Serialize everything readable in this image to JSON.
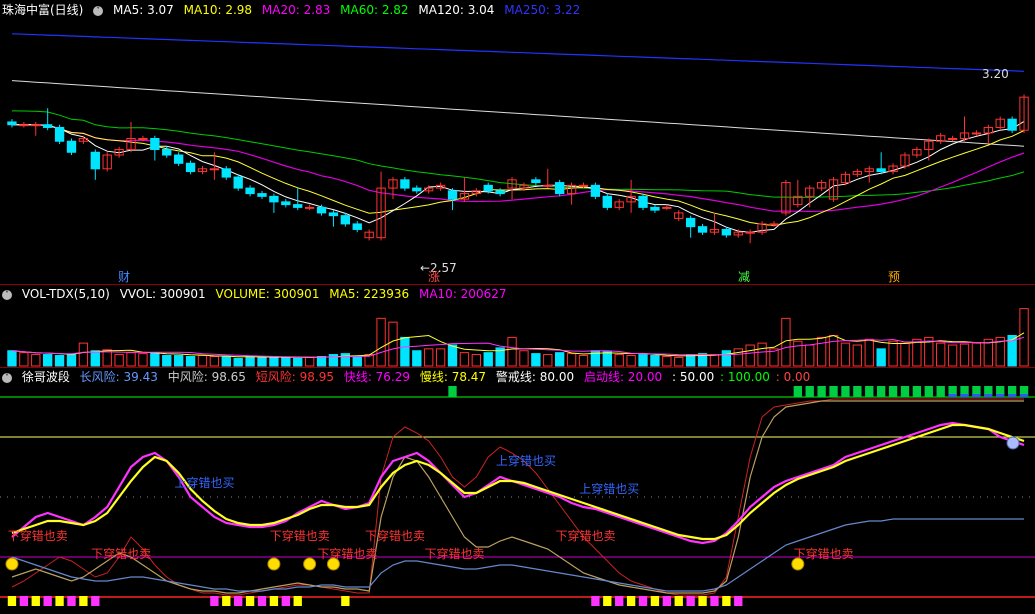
{
  "price_panel": {
    "security": "珠海中富(日线)",
    "indicators": [
      {
        "label": "MA5: 3.07",
        "color": "#ffffff"
      },
      {
        "label": "MA10: 2.98",
        "color": "#ffff00"
      },
      {
        "label": "MA20: 2.83",
        "color": "#ff00ff"
      },
      {
        "label": "MA60: 2.82",
        "color": "#00ff00"
      },
      {
        "label": "MA120: 3.04",
        "color": "#ffffff"
      },
      {
        "label": "MA250: 3.22",
        "color": "#3333ff"
      }
    ],
    "high_label": "3.20",
    "low_label": "2.57",
    "event_tags": [
      "财",
      "涨",
      "减",
      "预"
    ],
    "event_colors": [
      "#4488ff",
      "#ff4444",
      "#44ff44",
      "#ffaa00"
    ]
  },
  "volume_panel": {
    "title": "VOL-TDX(5,10)",
    "indicators": [
      {
        "label": "VVOL: 300901",
        "color": "#ffffff"
      },
      {
        "label": "VOLUME: 300901",
        "color": "#ffff00"
      },
      {
        "label": "MA5: 223936",
        "color": "#ffff00"
      },
      {
        "label": "MA10: 200627",
        "color": "#ff00ff"
      }
    ]
  },
  "oscillator_panel": {
    "title": "徐哥波段",
    "indicators": [
      {
        "label": "长风险: 39.43",
        "color": "#6699ff"
      },
      {
        "label": "中风险: 98.65",
        "color": "#cccccc"
      },
      {
        "label": "短风险: 98.95",
        "color": "#ff3333"
      },
      {
        "label": "快线: 76.29",
        "color": "#ff00ff"
      },
      {
        "label": "慢线: 78.47",
        "color": "#ffff00"
      },
      {
        "label": "警戒线: 80.00",
        "color": "#ffffff"
      },
      {
        "label": "启动线: 20.00",
        "color": "#ff00ff"
      },
      {
        "label": ": 50.00",
        "color": "#ffffff"
      },
      {
        "label": ": 100.00",
        "color": "#00ff00"
      },
      {
        "label": ": 0.00",
        "color": "#ff4444"
      }
    ],
    "buy_text": "上穿错也买",
    "sell_text": "下穿错也卖"
  },
  "chart_data": {
    "type": "candlestick",
    "x": [
      0,
      1,
      2,
      3,
      4,
      5,
      6,
      7,
      8,
      9,
      10,
      11,
      12,
      13,
      14,
      15,
      16,
      17,
      18,
      19,
      20,
      21,
      22,
      23,
      24,
      25,
      26,
      27,
      28,
      29,
      30,
      31,
      32,
      33,
      34,
      35,
      36,
      37,
      38,
      39,
      40,
      41,
      42,
      43,
      44,
      45,
      46,
      47,
      48,
      49,
      50,
      51,
      52,
      53,
      54,
      55,
      56,
      57,
      58,
      59,
      60,
      61,
      62,
      63,
      64,
      65,
      66,
      67,
      68,
      69,
      70,
      71,
      72,
      73,
      74,
      75,
      76,
      77,
      78,
      79,
      80,
      81,
      82,
      83,
      84,
      85
    ],
    "price": {
      "ylim": [
        2.5,
        3.4
      ],
      "open": [
        3.03,
        3.02,
        3.02,
        3.02,
        3.01,
        2.96,
        2.96,
        2.92,
        2.86,
        2.91,
        2.93,
        2.97,
        2.97,
        2.93,
        2.91,
        2.88,
        2.85,
        2.86,
        2.86,
        2.83,
        2.79,
        2.77,
        2.76,
        2.74,
        2.73,
        2.72,
        2.72,
        2.7,
        2.69,
        2.66,
        2.61,
        2.61,
        2.79,
        2.82,
        2.79,
        2.78,
        2.79,
        2.78,
        2.75,
        2.77,
        2.8,
        2.78,
        2.79,
        2.79,
        2.82,
        2.8,
        2.81,
        2.77,
        2.8,
        2.8,
        2.76,
        2.72,
        2.74,
        2.76,
        2.72,
        2.72,
        2.68,
        2.68,
        2.65,
        2.63,
        2.64,
        2.62,
        2.63,
        2.63,
        2.66,
        2.7,
        2.73,
        2.76,
        2.79,
        2.75,
        2.81,
        2.84,
        2.85,
        2.86,
        2.85,
        2.87,
        2.91,
        2.93,
        2.96,
        2.97,
        2.97,
        2.99,
        2.99,
        3.01,
        3.04,
        3.0
      ],
      "close": [
        3.02,
        3.02,
        3.02,
        3.01,
        2.96,
        2.92,
        2.97,
        2.86,
        2.91,
        2.93,
        2.97,
        2.97,
        2.93,
        2.91,
        2.88,
        2.85,
        2.86,
        2.86,
        2.83,
        2.79,
        2.77,
        2.76,
        2.74,
        2.73,
        2.72,
        2.72,
        2.7,
        2.69,
        2.66,
        2.64,
        2.63,
        2.79,
        2.82,
        2.79,
        2.78,
        2.79,
        2.8,
        2.75,
        2.77,
        2.78,
        2.78,
        2.77,
        2.82,
        2.8,
        2.81,
        2.8,
        2.77,
        2.8,
        2.8,
        2.76,
        2.72,
        2.74,
        2.76,
        2.72,
        2.71,
        2.72,
        2.7,
        2.65,
        2.63,
        2.64,
        2.62,
        2.63,
        2.63,
        2.66,
        2.66,
        2.81,
        2.76,
        2.79,
        2.81,
        2.82,
        2.84,
        2.85,
        2.86,
        2.85,
        2.87,
        2.91,
        2.93,
        2.96,
        2.98,
        2.97,
        2.99,
        2.99,
        3.01,
        3.04,
        3.0,
        3.12
      ]
    },
    "volume": {
      "ylim": [
        0,
        320000
      ],
      "values": [
        80000,
        70000,
        60000,
        60000,
        55000,
        60000,
        120000,
        80000,
        85000,
        60000,
        70000,
        65000,
        70000,
        55000,
        55000,
        50000,
        55000,
        50000,
        50000,
        40000,
        50000,
        45000,
        50000,
        45000,
        40000,
        45000,
        50000,
        60000,
        65000,
        50000,
        60000,
        250000,
        230000,
        150000,
        80000,
        90000,
        90000,
        110000,
        70000,
        60000,
        70000,
        95000,
        150000,
        80000,
        65000,
        60000,
        70000,
        65000,
        55000,
        80000,
        75000,
        60000,
        55000,
        60000,
        55000,
        50000,
        45000,
        60000,
        65000,
        60000,
        80000,
        90000,
        110000,
        120000,
        90000,
        250000,
        130000,
        110000,
        150000,
        160000,
        120000,
        110000,
        140000,
        90000,
        130000,
        120000,
        140000,
        150000,
        120000,
        110000,
        115000,
        120000,
        140000,
        150000,
        160000,
        300901
      ]
    },
    "oscillator": {
      "ylim": [
        0,
        100
      ],
      "fast": [
        30,
        35,
        40,
        42,
        40,
        38,
        36,
        40,
        45,
        55,
        65,
        70,
        72,
        68,
        60,
        50,
        45,
        40,
        37,
        36,
        35,
        35,
        36,
        38,
        42,
        45,
        48,
        46,
        44,
        45,
        47,
        60,
        68,
        70,
        72,
        68,
        62,
        56,
        50,
        52,
        56,
        60,
        58,
        56,
        54,
        52,
        50,
        47,
        45,
        44,
        42,
        40,
        38,
        36,
        34,
        32,
        30,
        28,
        27,
        28,
        32,
        38,
        45,
        50,
        55,
        58,
        60,
        62,
        64,
        66,
        70,
        72,
        74,
        76,
        78,
        80,
        82,
        84,
        86,
        87,
        86,
        85,
        84,
        80,
        78,
        76
      ],
      "slow": [
        32,
        34,
        36,
        38,
        38,
        37,
        36,
        38,
        42,
        50,
        58,
        65,
        70,
        68,
        62,
        54,
        48,
        43,
        39,
        37,
        36,
        36,
        37,
        39,
        41,
        44,
        46,
        46,
        45,
        45,
        46,
        55,
        62,
        66,
        68,
        66,
        62,
        57,
        52,
        52,
        55,
        58,
        58,
        57,
        55,
        53,
        51,
        49,
        47,
        45,
        43,
        41,
        39,
        37,
        35,
        33,
        31,
        30,
        29,
        29,
        31,
        36,
        42,
        47,
        52,
        56,
        59,
        61,
        63,
        65,
        68,
        70,
        72,
        74,
        76,
        78,
        80,
        82,
        84,
        86,
        86,
        85,
        84,
        82,
        80,
        78
      ],
      "long": [
        20,
        18,
        16,
        14,
        12,
        10,
        9,
        8,
        8,
        9,
        10,
        10,
        9,
        8,
        7,
        6,
        5,
        4,
        4,
        3,
        3,
        3,
        4,
        4,
        5,
        5,
        6,
        6,
        5,
        5,
        5,
        12,
        16,
        18,
        18,
        17,
        16,
        15,
        14,
        14,
        15,
        16,
        16,
        15,
        14,
        13,
        12,
        11,
        10,
        9,
        8,
        7,
        6,
        5,
        4,
        3,
        3,
        3,
        3,
        4,
        6,
        10,
        14,
        18,
        22,
        26,
        28,
        30,
        32,
        34,
        36,
        37,
        38,
        38,
        39,
        39,
        39,
        39,
        39,
        39,
        39,
        39,
        39,
        39,
        39,
        39
      ],
      "mid": [
        10,
        12,
        14,
        12,
        10,
        8,
        10,
        14,
        18,
        22,
        20,
        16,
        12,
        8,
        6,
        4,
        3,
        3,
        2,
        2,
        3,
        4,
        5,
        6,
        7,
        6,
        5,
        5,
        4,
        4,
        3,
        40,
        60,
        70,
        68,
        60,
        50,
        40,
        30,
        25,
        25,
        28,
        30,
        28,
        26,
        24,
        20,
        16,
        12,
        10,
        8,
        6,
        5,
        4,
        3,
        2,
        2,
        2,
        2,
        3,
        8,
        30,
        60,
        80,
        90,
        95,
        96,
        97,
        98,
        98,
        98,
        98,
        98,
        98,
        98,
        98,
        98,
        98,
        98,
        98,
        98,
        98,
        98,
        98,
        98,
        98
      ],
      "short": [
        5,
        8,
        12,
        16,
        20,
        18,
        14,
        10,
        12,
        20,
        30,
        24,
        16,
        10,
        6,
        4,
        2,
        2,
        1,
        1,
        2,
        3,
        4,
        5,
        6,
        6,
        5,
        4,
        3,
        2,
        2,
        60,
        80,
        85,
        82,
        78,
        70,
        60,
        55,
        60,
        70,
        75,
        72,
        68,
        62,
        54,
        46,
        38,
        30,
        24,
        18,
        12,
        8,
        6,
        4,
        2,
        1,
        1,
        1,
        2,
        10,
        40,
        70,
        90,
        95,
        96,
        97,
        98,
        98,
        99,
        99,
        99,
        99,
        99,
        99,
        99,
        99,
        99,
        99,
        99,
        99,
        99,
        99,
        99,
        99,
        99
      ],
      "warning_line": 80,
      "start_line": 20,
      "mid_line": 50,
      "top_line": 100,
      "bottom_line": 0
    }
  }
}
